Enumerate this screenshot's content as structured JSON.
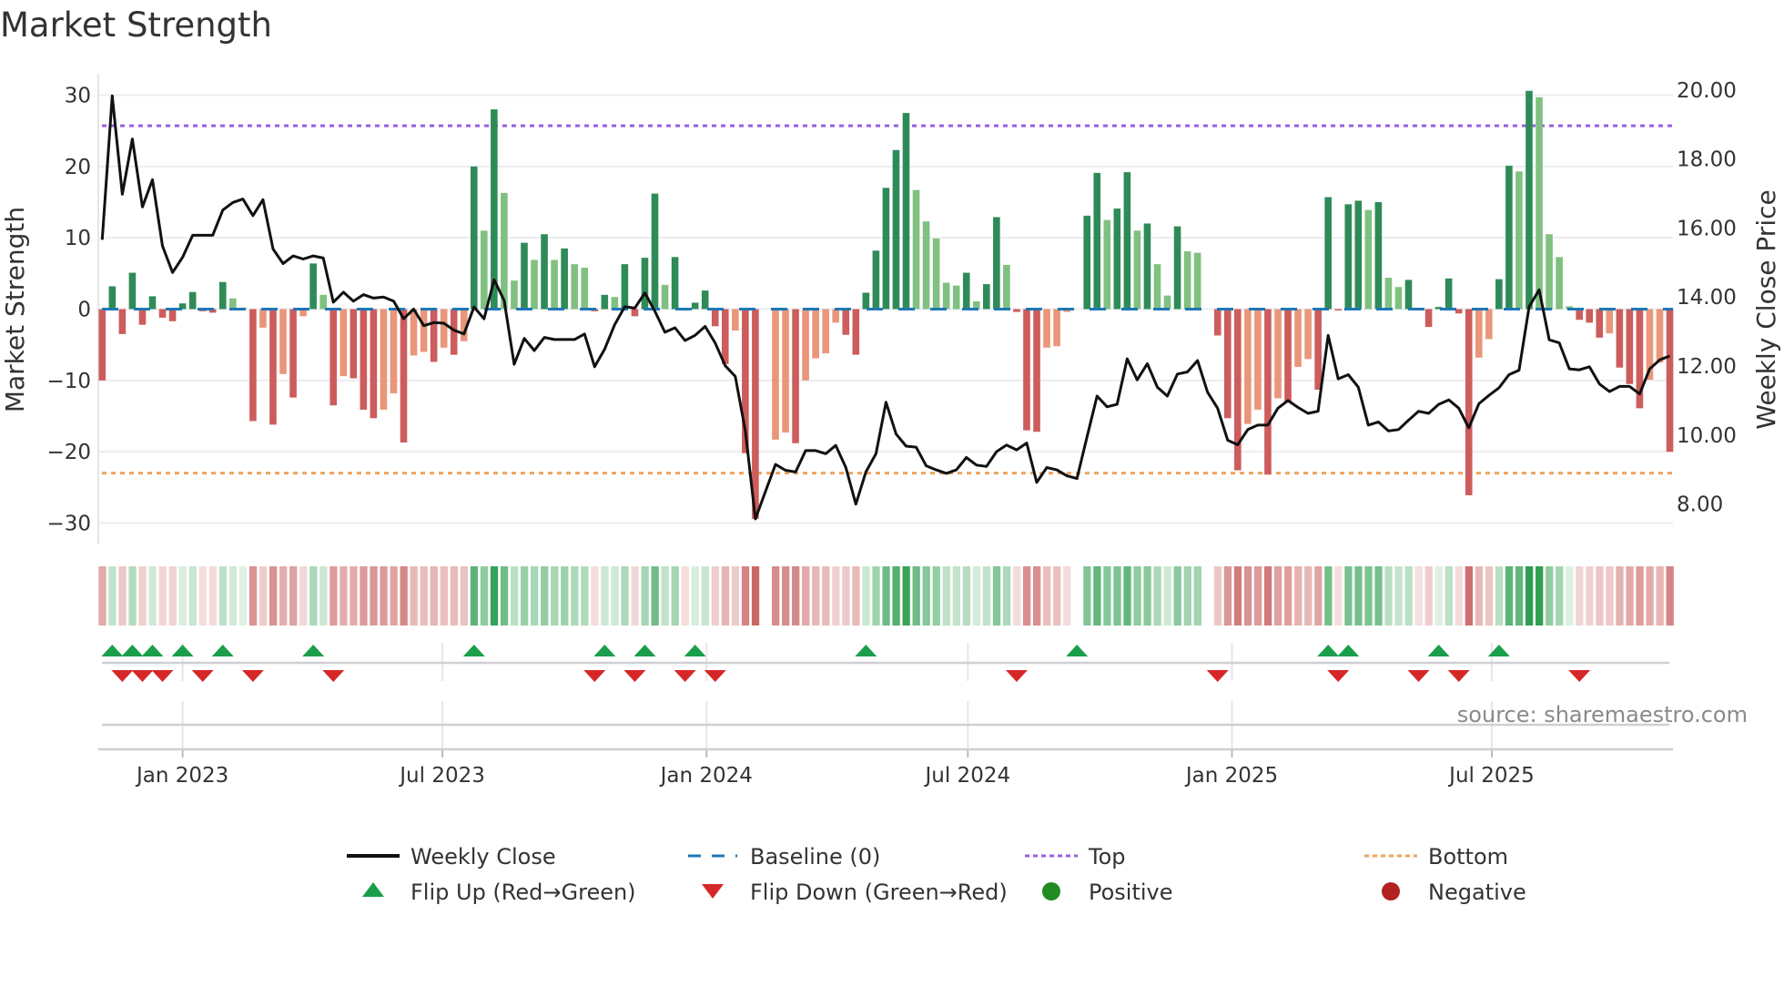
{
  "chart_data": {
    "type": "bar+line",
    "title": "Market Strength",
    "ylabel_left": "Market Strength",
    "ylabel_right": "Weekly Close Price",
    "ylim_left": [
      -33,
      33
    ],
    "ylim_right": [
      6.83,
      20.47
    ],
    "yticks_left": [
      "30",
      "20",
      "10",
      "0",
      "−10",
      "−20",
      "−30"
    ],
    "yticks_left_values": [
      30,
      20,
      10,
      0,
      -10,
      -20,
      -30
    ],
    "yticks_right": [
      "20.00",
      "18.00",
      "16.00",
      "14.00",
      "12.00",
      "10.00",
      "8.00"
    ],
    "yticks_right_values": [
      20,
      18,
      16,
      14,
      12,
      10,
      8
    ],
    "xticks": [
      {
        "label": "Jan 2023",
        "date": "2023-01-01"
      },
      {
        "label": "Jul 2023",
        "date": "2023-07-01"
      },
      {
        "label": "Jan 2024",
        "date": "2024-01-01"
      },
      {
        "label": "Jul 2024",
        "date": "2024-07-01"
      },
      {
        "label": "Jan 2025",
        "date": "2025-01-01"
      },
      {
        "label": "Jul 2025",
        "date": "2025-07-01"
      }
    ],
    "start_date": "2022-11-06",
    "interval_days": 7,
    "grid": true,
    "top_level": 25.7,
    "bottom_level": -23.0,
    "baseline": 0,
    "strength": [
      -10,
      3.2,
      -3.5,
      5.1,
      -2.2,
      1.8,
      -1.2,
      -1.7,
      0.8,
      2.4,
      -0.3,
      -0.5,
      3.8,
      1.5,
      0.2,
      -15.7,
      -2.6,
      -16.2,
      -9.1,
      -12.4,
      -1,
      6.4,
      2,
      -13.5,
      -9.4,
      -9.7,
      -14.1,
      -15.3,
      -14.1,
      -11.8,
      -18.7,
      -6.5,
      -6,
      -7.4,
      -5.4,
      -6.4,
      -4.5,
      20,
      11,
      28,
      16.3,
      4,
      9.3,
      6.9,
      10.5,
      6.9,
      8.5,
      6.3,
      5.8,
      -0.3,
      2,
      1.7,
      6.3,
      -1,
      7.2,
      16.2,
      3.4,
      7.3,
      -0.2,
      0.9,
      2.6,
      -2.4,
      -7.7,
      -3,
      -20.2,
      -29.4,
      0,
      -18.3,
      -17.3,
      -18.8,
      -10,
      -6.9,
      -6.2,
      -1.9,
      -3.6,
      -6.4,
      2.3,
      8.2,
      17,
      22.3,
      27.5,
      16.7,
      12.3,
      9.9,
      3.7,
      3.3,
      5.1,
      1.1,
      3.5,
      12.9,
      6.2,
      -0.4,
      -17,
      -17.2,
      -5.4,
      -5.2,
      -0.4,
      0,
      13.1,
      19.1,
      12.5,
      14.1,
      19.2,
      11,
      12,
      6.3,
      1.9,
      11.6,
      8.1,
      7.9,
      0,
      -3.7,
      -15.3,
      -22.6,
      -16.1,
      -14.1,
      -23.2,
      -12.5,
      -13.1,
      -8.1,
      -7,
      -11.3,
      15.7,
      -0.2,
      14.7,
      15.2,
      13.9,
      15,
      4.4,
      3.1,
      4.1,
      -0.1,
      -2.5,
      0.3,
      4.3,
      -0.6,
      -26.1,
      -6.8,
      -4.2,
      4.2,
      20.1,
      19.3,
      30.6,
      29.7,
      10.5,
      7.3,
      0.4,
      -1.5,
      -1.9,
      -4,
      -3.4,
      -8.2,
      -10.5,
      -13.9,
      -9.9,
      -7.5,
      -20
    ],
    "weekly_close": [
      15.66,
      19.83,
      16.98,
      18.58,
      16.61,
      17.4,
      15.48,
      14.71,
      15.15,
      15.79,
      15.79,
      15.79,
      16.52,
      16.74,
      16.84,
      16.36,
      16.82,
      15.39,
      14.97,
      15.19,
      15.1,
      15.19,
      15.13,
      13.85,
      14.14,
      13.88,
      14.07,
      13.97,
      14.0,
      13.88,
      13.37,
      13.65,
      13.17,
      13.26,
      13.24,
      13.04,
      12.93,
      13.71,
      13.37,
      14.5,
      13.9,
      12.05,
      12.8,
      12.45,
      12.83,
      12.77,
      12.77,
      12.77,
      12.93,
      11.98,
      12.49,
      13.2,
      13.72,
      13.68,
      14.12,
      13.59,
      12.98,
      13.11,
      12.74,
      12.89,
      13.15,
      12.67,
      12.01,
      11.7,
      10.12,
      7.57,
      8.36,
      9.15,
      8.98,
      8.93,
      9.55,
      9.55,
      9.46,
      9.7,
      9.06,
      8.0,
      8.93,
      9.46,
      10.95,
      10.03,
      9.68,
      9.65,
      9.11,
      8.99,
      8.89,
      8.99,
      9.35,
      9.13,
      9.09,
      9.52,
      9.71,
      9.57,
      9.77,
      8.63,
      9.06,
      8.99,
      8.82,
      8.74,
      9.94,
      11.13,
      10.82,
      10.89,
      12.21,
      11.6,
      12.07,
      11.39,
      11.13,
      11.77,
      11.83,
      12.16,
      11.24,
      10.78,
      9.85,
      9.72,
      10.16,
      10.29,
      10.29,
      10.78,
      11.0,
      10.8,
      10.63,
      10.69,
      12.89,
      11.63,
      11.75,
      11.39,
      10.29,
      10.38,
      10.12,
      10.16,
      10.43,
      10.69,
      10.63,
      10.89,
      11.02,
      10.78,
      10.21,
      10.91,
      11.15,
      11.37,
      11.75,
      11.88,
      13.72,
      14.21,
      12.76,
      12.67,
      11.92,
      11.89,
      11.98,
      11.48,
      11.26,
      11.41,
      11.41,
      11.19,
      11.92,
      12.18,
      12.29
    ],
    "flip_up_weeks": [
      1,
      3,
      5,
      8,
      12,
      21,
      37,
      50,
      54,
      59,
      76,
      97,
      122,
      124,
      133,
      139
    ],
    "flip_down_weeks": [
      2,
      4,
      6,
      10,
      15,
      23,
      49,
      53,
      58,
      61,
      91,
      111,
      123,
      131,
      135,
      147
    ],
    "colors": {
      "pos_strong": "#2e8b57",
      "pos_weak": "#80c080",
      "neg_strong": "#cd5c5c",
      "neg_weak": "#e9967a",
      "close": "#111111",
      "baseline": "#1f77b4",
      "top": "#9b5de5",
      "bottom": "#f0a35e",
      "flip_up": "#1a9e4a",
      "flip_down": "#d62728",
      "positive": "#228b22",
      "negative": "#b22222"
    },
    "legend": {
      "placement": "bottom",
      "items": [
        {
          "key": "close",
          "label": "Weekly Close"
        },
        {
          "key": "baseline",
          "label": "Baseline (0)"
        },
        {
          "key": "top",
          "label": "Top"
        },
        {
          "key": "bottom",
          "label": "Bottom"
        },
        {
          "key": "flip_up",
          "label": "Flip Up (Red→Green)"
        },
        {
          "key": "flip_down",
          "label": "Flip Down (Green→Red)"
        },
        {
          "key": "positive",
          "label": "Positive"
        },
        {
          "key": "negative",
          "label": "Negative"
        }
      ]
    },
    "source": "source: sharemaestro.com"
  }
}
